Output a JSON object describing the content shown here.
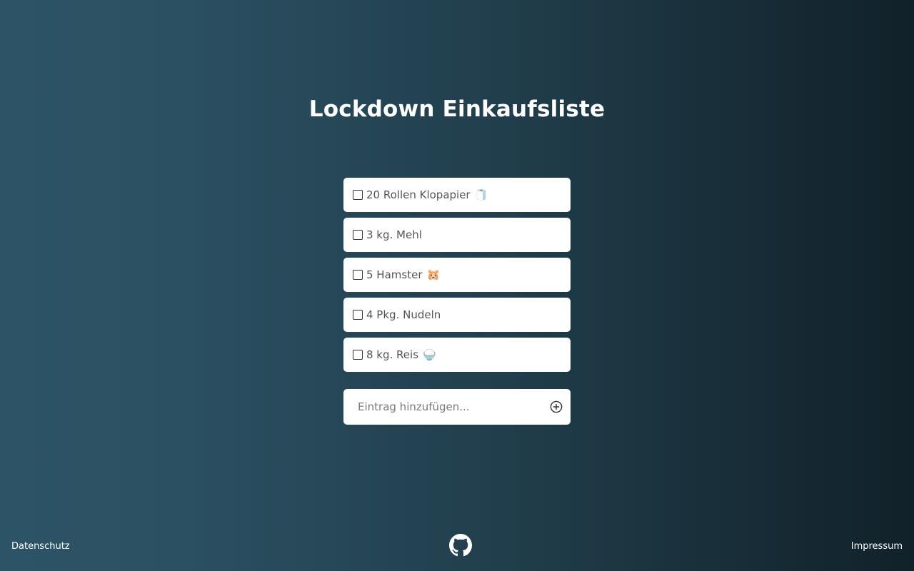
{
  "header": {
    "title": "Lockdown Einkaufsliste"
  },
  "list": {
    "items": [
      {
        "label": "20 Rollen Klopapier",
        "emoji": "🧻",
        "checked": false
      },
      {
        "label": "3 kg. Mehl",
        "emoji": "",
        "checked": false
      },
      {
        "label": "5 Hamster",
        "emoji": "🐹",
        "checked": false
      },
      {
        "label": "4 Pkg. Nudeln",
        "emoji": "",
        "checked": false
      },
      {
        "label": "8 kg. Reis",
        "emoji": "🍚",
        "checked": false
      }
    ]
  },
  "add_entry": {
    "placeholder": "Eintrag hinzufügen...",
    "value": "",
    "button_icon": "plus-circle-icon"
  },
  "footer": {
    "left_link": "Datenschutz",
    "right_link": "Impressum",
    "center_icon": "github-icon"
  },
  "colors": {
    "background_start": "#2d5466",
    "background_end": "#112129",
    "card": "#ffffff",
    "text_on_card": "#555555",
    "text_on_background": "#ffffff"
  }
}
